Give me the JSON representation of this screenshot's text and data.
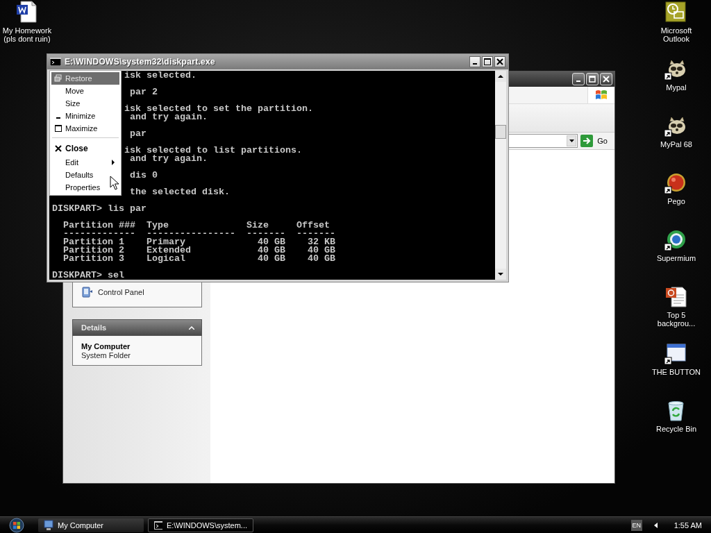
{
  "desktop": {
    "left_icons": [
      {
        "label": "My Homework (pls dont ruin)",
        "kind": "word",
        "shortcut": false
      }
    ],
    "right_icons": [
      {
        "label": "Microsoft Outlook",
        "kind": "outlook",
        "shortcut": false
      },
      {
        "label": "Mypal",
        "kind": "mypal",
        "shortcut": true
      },
      {
        "label": "MyPal 68",
        "kind": "mypal",
        "shortcut": true
      },
      {
        "label": "Pego",
        "kind": "pego",
        "shortcut": true
      },
      {
        "label": "Supermium",
        "kind": "supermium",
        "shortcut": true
      },
      {
        "label": "Top 5 backgrou...",
        "kind": "slides",
        "shortcut": false
      },
      {
        "label": "THE BUTTON",
        "kind": "window",
        "shortcut": true
      },
      {
        "label": "Recycle Bin",
        "kind": "recycle",
        "shortcut": false
      }
    ]
  },
  "explorer": {
    "go_label": "Go",
    "tasks": [
      {
        "label": "Control Panel"
      }
    ],
    "details": {
      "title": "Details",
      "expanded": true,
      "name": "My Computer",
      "subtitle": "System Folder"
    }
  },
  "console": {
    "title": "E:\\WINDOWS\\system32\\diskpart.exe",
    "blocks": [
      {
        "lines": [
          {
            "text": "isk selected.",
            "kind": "clipped"
          }
        ]
      },
      {
        "lines": [
          {
            "text": " par 2",
            "kind": "clipped"
          }
        ]
      },
      {
        "lines": [
          {
            "text": "isk selected to set the partition.",
            "kind": "clipped"
          },
          {
            "text": " and try again.",
            "kind": "clipped"
          }
        ]
      },
      {
        "lines": [
          {
            "text": " par",
            "kind": "clipped"
          }
        ]
      },
      {
        "lines": [
          {
            "text": "isk selected to list partitions.",
            "kind": "clipped"
          },
          {
            "text": " and try again.",
            "kind": "clipped"
          }
        ]
      },
      {
        "lines": [
          {
            "text": " dis 0",
            "kind": "clipped"
          }
        ]
      },
      {
        "lines": [
          {
            "text": " the selected disk.",
            "kind": "clipped"
          }
        ]
      },
      {
        "lines": [
          {
            "text": "DISKPART> lis par",
            "kind": "full"
          }
        ]
      },
      {
        "lines": [
          {
            "text": "  Partition ###  Type              Size     Offset",
            "kind": "full"
          },
          {
            "text": "  -------------  ----------------  -------  -------",
            "kind": "full"
          },
          {
            "text": "  Partition 1    Primary             40 GB    32 KB",
            "kind": "full"
          },
          {
            "text": "  Partition 2    Extended            40 GB    40 GB",
            "kind": "full"
          },
          {
            "text": "  Partition 3    Logical             40 GB    40 GB",
            "kind": "full"
          }
        ]
      },
      {
        "lines": [
          {
            "text": "DISKPART> sel",
            "kind": "full"
          }
        ]
      }
    ],
    "menu": {
      "items": [
        {
          "label": "Restore",
          "kind": "restore",
          "disabled": true,
          "selected": true,
          "default": false,
          "separator_before": false
        },
        {
          "label": "Move",
          "kind": "plain",
          "disabled": false,
          "selected": false,
          "default": false,
          "separator_before": false
        },
        {
          "label": "Size",
          "kind": "plain",
          "disabled": false,
          "selected": false,
          "default": false,
          "separator_before": false
        },
        {
          "label": "Minimize",
          "kind": "minimize",
          "disabled": false,
          "selected": false,
          "default": false,
          "separator_before": false
        },
        {
          "label": "Maximize",
          "kind": "maximize",
          "disabled": false,
          "selected": false,
          "default": false,
          "separator_before": false
        },
        {
          "label": "Close",
          "kind": "close",
          "disabled": false,
          "selected": false,
          "default": true,
          "separator_before": true
        },
        {
          "label": "Edit",
          "kind": "submenu",
          "disabled": false,
          "selected": false,
          "default": false,
          "separator_before": false
        },
        {
          "label": "Defaults",
          "kind": "plain",
          "disabled": false,
          "selected": false,
          "default": false,
          "separator_before": false
        },
        {
          "label": "Properties",
          "kind": "plain",
          "disabled": false,
          "selected": false,
          "default": false,
          "separator_before": false
        }
      ]
    }
  },
  "taskbar": {
    "tasks": [
      {
        "label": "My Computer",
        "kind": "computer",
        "selected": false
      },
      {
        "label": "E:\\WINDOWS\\system...",
        "kind": "console",
        "selected": true
      }
    ],
    "language": "EN",
    "clock": "1:55 AM"
  }
}
